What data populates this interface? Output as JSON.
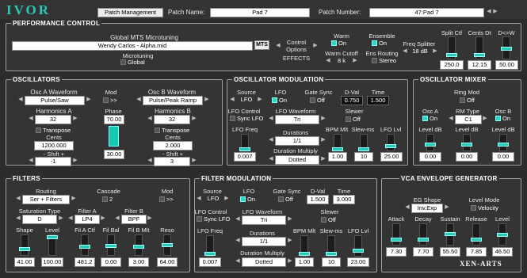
{
  "header": {
    "logo": "IVOR",
    "patch_mgmt": "Patch Management",
    "patch_name_label": "Patch Name:",
    "patch_name": "Pad 7",
    "patch_number_label": "Patch Number:",
    "patch_number": "47:Pad 7"
  },
  "perf": {
    "title": "PERFORMANCE CONTROL",
    "mts_label": "Global MTS Microtuning",
    "mts_value": "Wendy Carlos - Alpha.mid",
    "mts_btn": "MTS",
    "micro_label": "Microtuning",
    "global": "Global",
    "ctrl1": "Control",
    "ctrl2": "Options",
    "effects": "EFFECTS",
    "warm": "Warm",
    "warm_on": "On",
    "ensemble": "Ensemble",
    "ens_on": "On",
    "warm_cutoff": "Warm Cutoff",
    "warm_cutoff_val": "8 k",
    "ens_routing": "Ens Routing",
    "stereo": "Stereo",
    "freq_split": "Freq Splitter",
    "freq_split_val": "18 dB",
    "split_ctf": "Split Ctf",
    "split_ctf_val": "250.0",
    "cents_dt": "Cents Dt",
    "cents_dt_val": "12.15",
    "dw": "D<>W",
    "dw_val": "50.00"
  },
  "osc": {
    "title": "OSCILLATORS",
    "osca_wave": "Osc A Waveform",
    "osca_val": "Pulse/Saw",
    "mod": "Mod",
    "mod_val": ">>",
    "oscb_wave": "Osc B Waveform",
    "oscb_val": "Pulse/Peak Ramp",
    "harm_a": "Harmonics A",
    "harm_a_val": "32",
    "harm_b": "Harmonics B",
    "harm_b_val": "32",
    "phase": "Phase",
    "phase_val": "70.00",
    "phase_bot": "30.00",
    "transpose": "Transpose",
    "cents": "Cents",
    "cents_a": "1200.000",
    "cents_b": "2.000",
    "shift": "- Shift +",
    "shift_a": "-1",
    "shift_b": "3"
  },
  "oscmod": {
    "title": "OSCILLATOR MODULATION",
    "source": "Source",
    "source_val": "LFO",
    "lfo": "LFO",
    "lfo_on": "On",
    "gate_sync": "Gate Sync",
    "gate_off": "Off",
    "dval": "D-Val",
    "dval_val": "0.750",
    "time": "Time",
    "time_val": "1.500",
    "lfo_ctrl": "LFO Control",
    "sync_lfo": "Sync LFO",
    "lfo_wave": "LFO Waveform",
    "lfo_wave_val": "Tri",
    "slewer": "Slewer",
    "slewer_val": "Off",
    "lfo_freq": "LFO Freq",
    "lfo_freq_val": "0.007",
    "durations": "Durations",
    "durations_val": "1/1",
    "bpm": "BPM Mlt",
    "bpm_val": "1.00",
    "slew": "Slew-ms",
    "slew_val": "10",
    "lfo_lvl": "LFO Lvl",
    "lfo_lvl_val": "25.00",
    "dur_mult": "Duration Multiply",
    "dur_mult_val": "Dotted"
  },
  "mixer": {
    "title": "OSCILLATOR MIXER",
    "ringmod": "Ring Mod",
    "ringmod_val": "Off",
    "osca": "Osc A",
    "osca_on": "On",
    "rmtype": "RM Type",
    "rmtype_val": "C1",
    "oscb": "Osc B",
    "oscb_on": "On",
    "lvl": "Level dB",
    "lvl_a": "0.00",
    "lvl_rm": "0.00",
    "lvl_b": "0.00"
  },
  "filters": {
    "title": "FILTERS",
    "routing": "Routing",
    "routing_val": "Ser + Filters",
    "cascade": "Cascade",
    "cascade_val": "2",
    "mod": "Mod",
    "mod_val": ">>",
    "sat_type": "Saturation Type",
    "sat_val": "D",
    "fa": "Filter A",
    "fa_val": "LP4",
    "fb": "Filter B",
    "fb_val": "BPF",
    "shape": "Shape",
    "level": "Level",
    "fila": "Fil A Ctf",
    "filbal": "Fil Bal",
    "filb": "Fil B Mlt",
    "reso": "Reso",
    "v_shape": "41.00",
    "v_level": "100.00",
    "v_fila": "481.2",
    "v_filbal": "0.00",
    "v_filb": "3.00",
    "v_reso": "64.00"
  },
  "filtmod": {
    "title": "FILTER MODULATION",
    "source": "Source",
    "source_val": "LFO",
    "lfo": "LFO",
    "lfo_on": "On",
    "gate_sync": "Gate Sync",
    "gate_off": "Off",
    "dval": "D-Val",
    "dval_val": "1.500",
    "time": "Time",
    "time_val": "3.000",
    "lfo_ctrl": "LFO Control",
    "sync_lfo": "Sync LFO",
    "lfo_wave": "LFO Waveform",
    "lfo_wave_val": "Tri",
    "slewer": "Slewer",
    "slewer_val": "Off",
    "lfo_freq": "LFO Freq",
    "lfo_freq_val": "0.007",
    "durations": "Durations",
    "durations_val": "1/1",
    "bpm": "BPM Mlt",
    "bpm_val": "1.00",
    "slew": "Slew-ms",
    "slew_val": "10",
    "lfo_lvl": "LFO Lvl",
    "lfo_lvl_val": "23.00",
    "dur_mult": "Duration Multiply",
    "dur_mult_val": "Dotted"
  },
  "vca": {
    "title": "VCA ENVELOPE GENERATOR",
    "eg_shape": "EG Shape",
    "eg_val": "Inv.Exp",
    "lvl_mode": "Level Mode",
    "velocity": "Velocity",
    "attack": "Attack",
    "decay": "Decay",
    "sustain": "Sustain",
    "release": "Release",
    "level": "Level",
    "v_attack": "7.30",
    "v_decay": "7.70",
    "v_sustain": "55.50",
    "v_release": "7.85",
    "v_level": "46.50",
    "brand": "XEN-ARTS"
  },
  "colors": {
    "accent": "#2ac9b6",
    "panel": "#343434"
  }
}
